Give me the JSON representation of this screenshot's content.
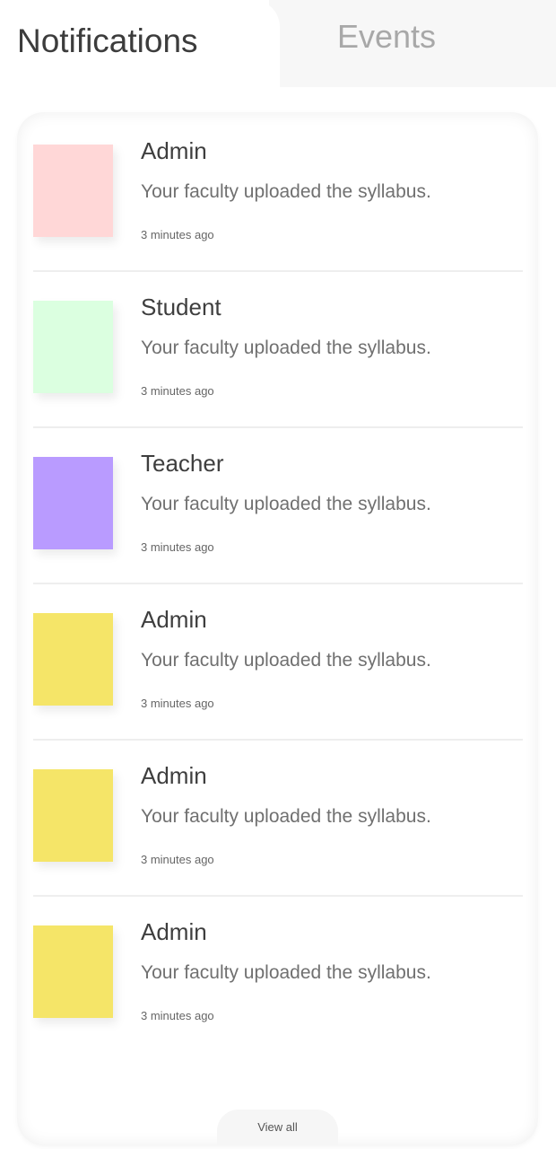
{
  "tabs": [
    {
      "label": "Notifications",
      "active": true
    },
    {
      "label": "Events",
      "active": false
    }
  ],
  "notifications": [
    {
      "title": "Admin",
      "message": "Your faculty uploaded the syllabus.",
      "time": "3 minutes ago",
      "color": "#ffd7d7"
    },
    {
      "title": "Student",
      "message": "Your faculty uploaded the syllabus.",
      "time": "3 minutes ago",
      "color": "#dbffe0"
    },
    {
      "title": "Teacher",
      "message": "Your faculty uploaded the syllabus.",
      "time": "3 minutes ago",
      "color": "#b99bff"
    },
    {
      "title": "Admin",
      "message": "Your faculty uploaded the syllabus.",
      "time": "3 minutes ago",
      "color": "#f5e568"
    },
    {
      "title": "Admin",
      "message": "Your faculty uploaded the syllabus.",
      "time": "3 minutes ago",
      "color": "#f5e568"
    },
    {
      "title": "Admin",
      "message": "Your faculty uploaded the syllabus.",
      "time": "3 minutes ago",
      "color": "#f5e568"
    }
  ],
  "view_all_label": "View all"
}
